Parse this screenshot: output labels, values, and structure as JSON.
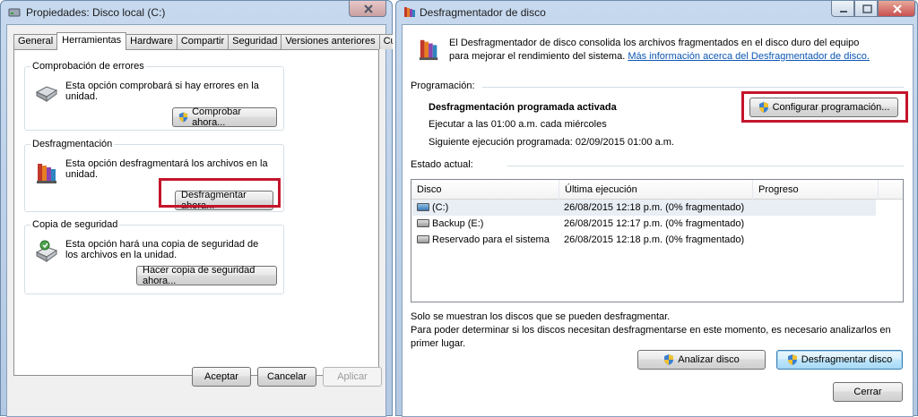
{
  "left_window": {
    "title": "Propiedades: Disco local (C:)",
    "tabs": [
      "General",
      "Herramientas",
      "Hardware",
      "Compartir",
      "Seguridad",
      "Versiones anteriores",
      "Cuota"
    ],
    "active_tab": "Herramientas",
    "groups": {
      "errors": {
        "title": "Comprobación de errores",
        "text": "Esta opción comprobará si hay errores en la unidad.",
        "button": "Comprobar ahora...",
        "icon": "hard-drive-icon"
      },
      "defrag": {
        "title": "Desfragmentación",
        "text": "Esta opción desfragmentará los archivos en la unidad.",
        "button": "Desfragmentar ahora...",
        "icon": "defrag-icon"
      },
      "backup": {
        "title": "Copia de seguridad",
        "text": "Esta opción hará una copia de seguridad de los archivos en la unidad.",
        "button": "Hacer copia de seguridad ahora...",
        "icon": "backup-icon"
      }
    },
    "buttons": {
      "ok": "Aceptar",
      "cancel": "Cancelar",
      "apply": "Aplicar"
    }
  },
  "right_window": {
    "title": "Desfragmentador de disco",
    "intro_text": "El Desfragmentador de disco consolida los archivos fragmentados en el disco duro del equipo para mejorar el rendimiento del sistema.",
    "intro_link": "Más información acerca del Desfragmentador de disco.",
    "schedule": {
      "label": "Programación:",
      "status": "Desfragmentación programada activada",
      "run_at": "Ejecutar a las 01:00 a.m. cada miércoles",
      "next_run": "Siguiente ejecución programada: 02/09/2015 01:00 a.m.",
      "configure_button": "Configurar programación..."
    },
    "current_state_label": "Estado actual:",
    "table": {
      "columns": [
        "Disco",
        "Última ejecución",
        "Progreso"
      ],
      "rows": [
        {
          "disk": "(C:)",
          "last_run": "26/08/2015 12:18 p.m. (0% fragmentado)",
          "progress": ""
        },
        {
          "disk": "Backup (E:)",
          "last_run": "26/08/2015 12:17 p.m. (0% fragmentado)",
          "progress": ""
        },
        {
          "disk": "Reservado para el sistema",
          "last_run": "26/08/2015 12:18 p.m. (0% fragmentado)",
          "progress": ""
        }
      ]
    },
    "footer_note1": "Solo se muestran los discos que se pueden desfragmentar.",
    "footer_note2": "Para poder determinar si los discos necesitan desfragmentarse en este momento, es necesario analizarlos en primer lugar.",
    "analyze_button": "Analizar disco",
    "defrag_button": "Desfragmentar disco",
    "close_button": "Cerrar"
  },
  "colors": {
    "highlight_box": "#c4152c",
    "link": "#0b56b5",
    "titlebar": "#c7d9ee",
    "close_button": "#c75050"
  }
}
